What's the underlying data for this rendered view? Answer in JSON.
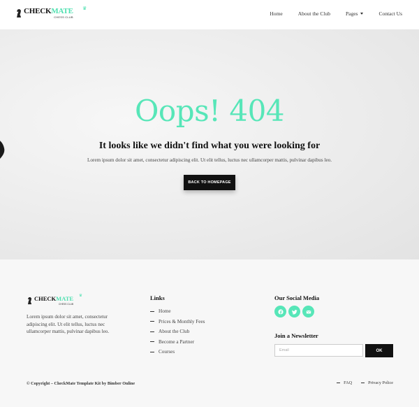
{
  "header": {
    "logo": {
      "name_dark": "CHECK",
      "name_accent": "MATE",
      "subtitle": "CHESS CLUB"
    },
    "nav": [
      {
        "label": "Home"
      },
      {
        "label": "About the Club"
      },
      {
        "label": "Pages",
        "has_dropdown": true
      },
      {
        "label": "Contact Us"
      }
    ]
  },
  "hero": {
    "title": "Oops! 404",
    "subtitle": "It looks like we didn't find what you were looking for",
    "text": "Lorem ipsum dolor sit amet, consectetur adipiscing elit. Ut elit tellus, luctus nec ullamcorper mattis, pulvinar dapibus leo.",
    "button_label": "BACK TO HOMEPAGE"
  },
  "footer": {
    "logo": {
      "name_dark": "CHECK",
      "name_accent": "MATE",
      "subtitle": "CHESS CLUB"
    },
    "about": "Lorem ipsum dolor sit amet, consectetur adipiscing elit. Ut elit tellus, luctus nec ullamcorper mattis, pulvinar dapibus leo.",
    "links_heading": "Links",
    "links": [
      "Home",
      "Prices & Monthly Fees",
      "About the Club",
      "Become a Partner",
      "Courses"
    ],
    "social_heading": "Our Social Media",
    "social_icons": [
      "facebook-icon",
      "twitter-icon",
      "email-icon"
    ],
    "newsletter_heading": "Join a Newsletter",
    "email_placeholder": "Email",
    "ok_label": "OK",
    "copyright": "© Copyright – CheckMate Template Kit by Bimber Online",
    "bottom_links": [
      "FAQ",
      "Privacy Police"
    ]
  },
  "colors": {
    "accent": "#57e6b8",
    "dark": "#111111",
    "hero_bg": "#e8e8e8",
    "footer_bg": "#f7f7f7"
  }
}
